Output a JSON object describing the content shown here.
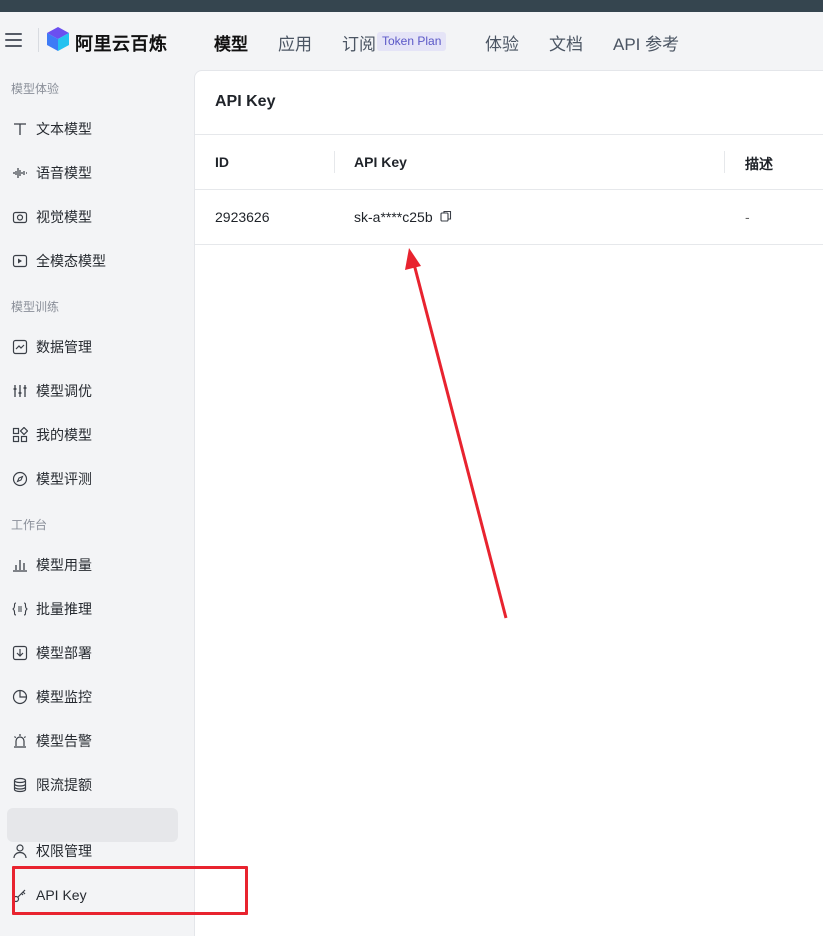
{
  "app": {
    "brand": "阿里云百炼",
    "nav": [
      {
        "label": "模型",
        "active": true
      },
      {
        "label": "应用",
        "active": false
      },
      {
        "label": "订阅",
        "active": false
      },
      {
        "label": "体验",
        "active": false
      },
      {
        "label": "文档",
        "active": false
      },
      {
        "label": "API 参考",
        "active": false
      }
    ],
    "subscribe_badge": "Token Plan"
  },
  "sidebar": {
    "sections": [
      {
        "title": "模型体验",
        "items": [
          {
            "label": "文本模型",
            "icon": "text-icon"
          },
          {
            "label": "语音模型",
            "icon": "waveform-icon"
          },
          {
            "label": "视觉模型",
            "icon": "camera-icon"
          },
          {
            "label": "全模态模型",
            "icon": "media-icon"
          }
        ]
      },
      {
        "title": "模型训练",
        "items": [
          {
            "label": "数据管理",
            "icon": "chart-icon"
          },
          {
            "label": "模型调优",
            "icon": "sliders-icon"
          },
          {
            "label": "我的模型",
            "icon": "grid-icon"
          },
          {
            "label": "模型评测",
            "icon": "compass-icon"
          }
        ]
      },
      {
        "title": "工作台",
        "items": [
          {
            "label": "模型用量",
            "icon": "bar-chart-icon"
          },
          {
            "label": "批量推理",
            "icon": "braces-icon"
          },
          {
            "label": "模型部署",
            "icon": "download-box-icon"
          },
          {
            "label": "模型监控",
            "icon": "pie-icon"
          },
          {
            "label": "模型告警",
            "icon": "alarm-icon"
          },
          {
            "label": "限流提额",
            "icon": "database-icon"
          }
        ]
      }
    ],
    "bottom_items": [
      {
        "label": "权限管理",
        "icon": "user-icon"
      },
      {
        "label": "API Key",
        "icon": "key-icon",
        "active": true
      }
    ]
  },
  "main": {
    "title": "API Key",
    "table": {
      "columns": [
        "ID",
        "API Key",
        "描述"
      ],
      "rows": [
        {
          "id": "2923626",
          "api_key": "sk-a****c25b",
          "description": "-"
        }
      ]
    }
  },
  "colors": {
    "accent": "#5a57c7",
    "annotation": "#e8232f"
  }
}
